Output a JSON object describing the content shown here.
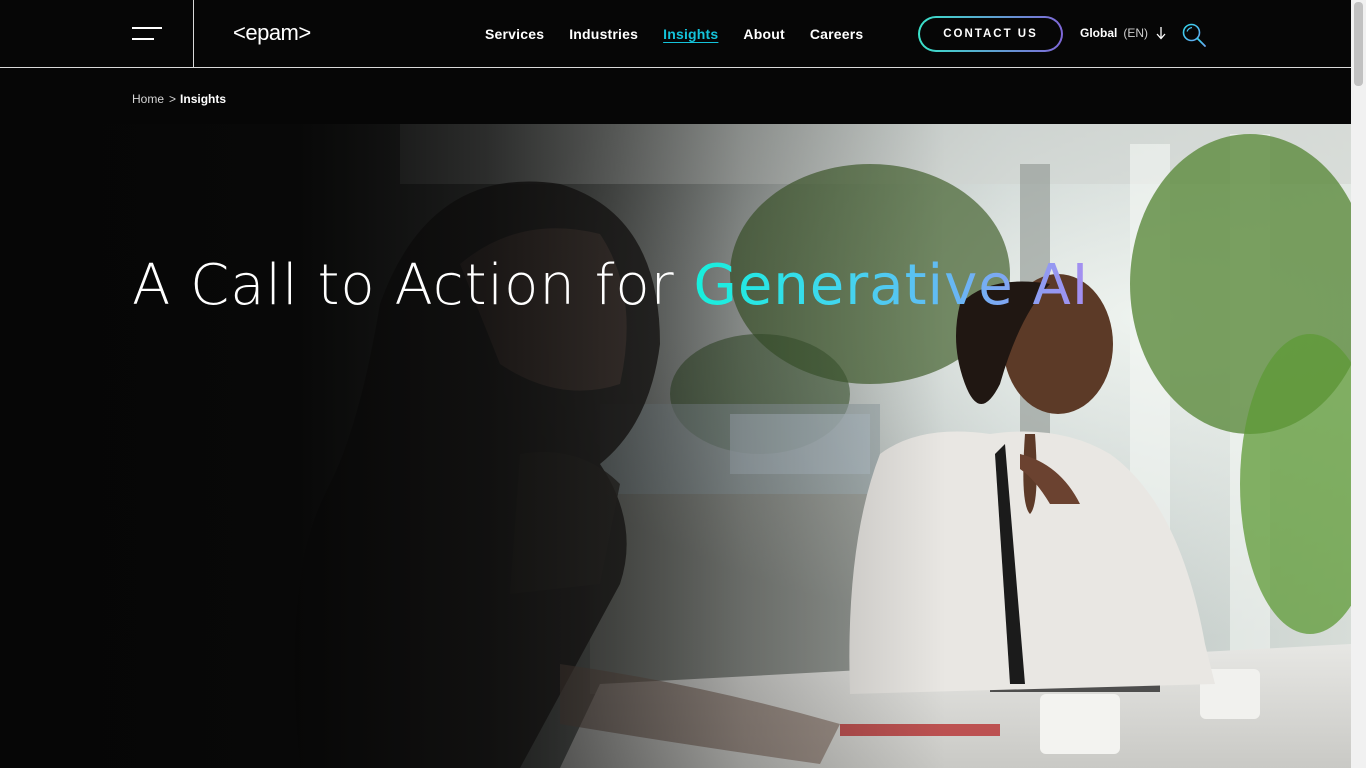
{
  "header": {
    "logo": "<epam>",
    "nav": [
      {
        "label": "Services",
        "active": false
      },
      {
        "label": "Industries",
        "active": false
      },
      {
        "label": "Insights",
        "active": true
      },
      {
        "label": "About",
        "active": false
      },
      {
        "label": "Careers",
        "active": false
      }
    ],
    "contact_label": "CONTACT US",
    "language": {
      "region": "Global",
      "code": "(EN)"
    },
    "icons": {
      "menu": "hamburger-menu-icon",
      "language_arrow": "arrow-down-icon",
      "search": "search-icon"
    }
  },
  "breadcrumb": {
    "home": "Home",
    "separator": ">",
    "current": "Insights"
  },
  "hero": {
    "title_prefix": "A Call to Action for ",
    "title_highlight": "Generative AI"
  },
  "colors": {
    "background": "#060606",
    "accent_teal": "#14c3da",
    "gradient_start": "#16f0dc",
    "gradient_end": "#a68df0",
    "button_border_start": "#39e2c9",
    "button_border_end": "#7f67d8"
  }
}
